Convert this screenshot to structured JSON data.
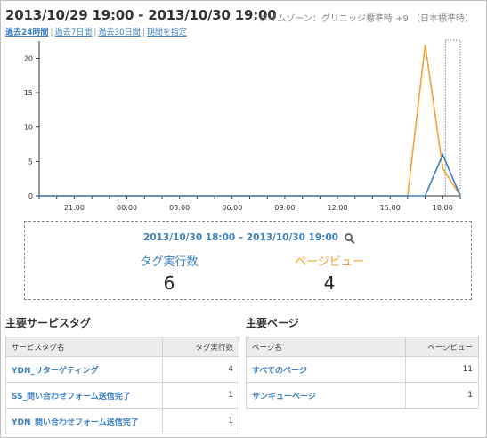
{
  "header": {
    "title": "2013/10/29 19:00 - 2013/10/30 19:00",
    "timezone": "タイムゾーン：グリニッジ標準時 +9 （日本標準時）"
  },
  "ranges": [
    {
      "label": "過去24時間",
      "active": true
    },
    {
      "label": "過去7日間",
      "active": false
    },
    {
      "label": "過去30日間",
      "active": false
    },
    {
      "label": "期間を指定",
      "active": false
    }
  ],
  "chart_data": {
    "type": "line",
    "x_tick_labels": [
      "21:00",
      "00:00",
      "03:00",
      "06:00",
      "09:00",
      "12:00",
      "15:00",
      "18:00"
    ],
    "y_ticks": [
      0,
      5,
      10,
      15,
      20
    ],
    "ylim": [
      0,
      22
    ],
    "grid": false,
    "x_hours": [
      19,
      20,
      21,
      22,
      23,
      0,
      1,
      2,
      3,
      4,
      5,
      6,
      7,
      8,
      9,
      10,
      11,
      12,
      13,
      14,
      15,
      16,
      17,
      18,
      19
    ],
    "series": [
      {
        "name": "タグ実行数",
        "color": "#3d7fbf",
        "values": [
          0,
          0,
          0,
          0,
          0,
          0,
          0,
          0,
          0,
          0,
          0,
          0,
          0,
          0,
          0,
          0,
          0,
          0,
          0,
          0,
          0,
          0,
          0,
          6,
          0
        ]
      },
      {
        "name": "ページビュー",
        "color": "#f5a23a",
        "values": [
          0,
          0,
          0,
          0,
          0,
          0,
          0,
          0,
          0,
          0,
          0,
          0,
          0,
          0,
          0,
          0,
          0,
          0,
          0,
          0,
          0,
          0,
          22,
          4,
          0
        ]
      }
    ],
    "highlight_index": 23
  },
  "detail": {
    "range": "2013/10/30 18:00 – 2013/10/30 19:00",
    "tag_label": "タグ実行数",
    "tag_value": "6",
    "pv_label": "ページビュー",
    "pv_value": "4"
  },
  "service_tags": {
    "title": "主要サービスタグ",
    "col_name": "サービスタグ名",
    "col_count": "タグ実行数",
    "rows": [
      {
        "name": "YDN_リターゲティング",
        "count": "4"
      },
      {
        "name": "SS_問い合わせフォーム送信完了",
        "count": "1"
      },
      {
        "name": "YDN_問い合わせフォーム送信完了",
        "count": "1"
      }
    ]
  },
  "pages": {
    "title": "主要ページ",
    "col_name": "ページ名",
    "col_count": "ページビュー",
    "rows": [
      {
        "name": "すべてのページ",
        "count": "11"
      },
      {
        "name": "サンキューページ",
        "count": "1"
      }
    ]
  }
}
